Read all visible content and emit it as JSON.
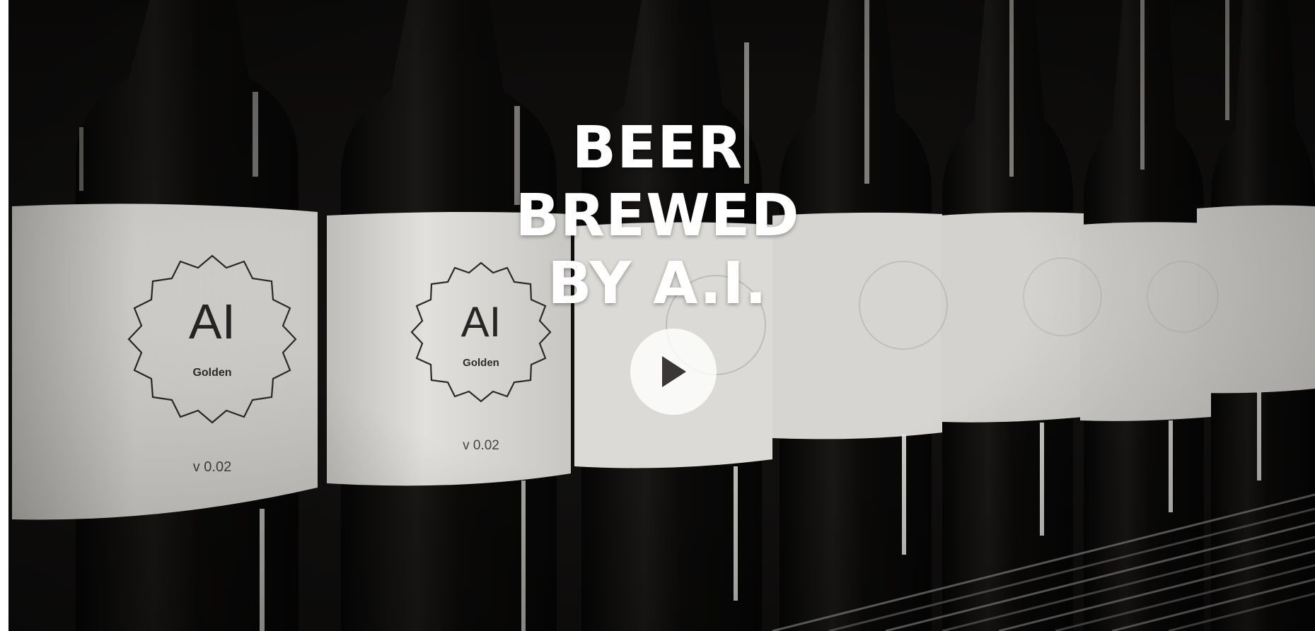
{
  "hero": {
    "headline_lines": [
      "BEER",
      "BREWED",
      "BY A.I."
    ],
    "play_icon": "play-icon"
  },
  "bottle_labels": [
    {
      "name": "AI",
      "variant": "Golden",
      "version": "v 0.02"
    },
    {
      "name": "AI",
      "variant": "Golden",
      "version": "v 0.02"
    }
  ],
  "colors": {
    "background": "#0f0e0d",
    "label": "#dddbd7",
    "headline": "#ffffff",
    "play_button": "#e8e7e5"
  }
}
